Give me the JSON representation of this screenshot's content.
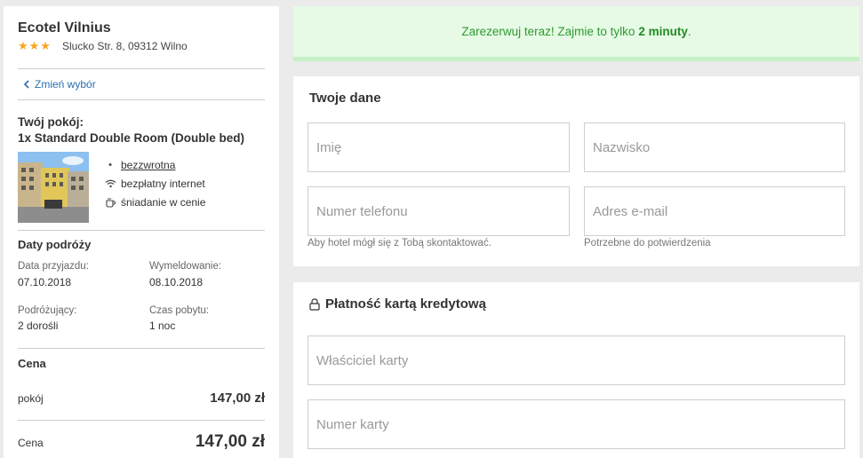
{
  "hotel": {
    "name": "Ecotel Vilnius",
    "stars": "★★★",
    "address": "Slucko Str. 8, 09312 Wilno"
  },
  "change_selection": "Zmień wybór",
  "room": {
    "line1": "Twój pokój:",
    "line2": "1x Standard Double Room (Double bed)",
    "features": [
      {
        "icon": "bullet-icon",
        "label": "bezzwrotna"
      },
      {
        "icon": "wifi-icon",
        "label": "bezpłatny internet"
      },
      {
        "icon": "coffee-cup-icon",
        "label": "śniadanie w cenie"
      }
    ]
  },
  "travel": {
    "title": "Daty podróży",
    "checkin_label": "Data przyjazdu:",
    "checkin_value": "07.10.2018",
    "checkout_label": "Wymeldowanie:",
    "checkout_value": "08.10.2018",
    "guests_label": "Podróżujący:",
    "guests_value": "2 dorośli",
    "stay_label": "Czas pobytu:",
    "stay_value": "1 noc"
  },
  "price": {
    "title": "Cena",
    "room_label": "pokój",
    "room_value": "147,00 zł",
    "total_label": "Cena",
    "total_value": "147,00 zł"
  },
  "banner": {
    "text": "Zarezerwuj teraz! Zajmie to tylko",
    "highlight": "2 minuty",
    "suffix": "."
  },
  "personal": {
    "title": "Twoje dane",
    "first_name_placeholder": "Imię",
    "last_name_placeholder": "Nazwisko",
    "phone_placeholder": "Numer telefonu",
    "email_placeholder": "Adres e-mail",
    "phone_hint": "Aby hotel mógł się z Tobą skontaktować.",
    "email_hint": "Potrzebne do potwierdzenia"
  },
  "payment": {
    "title": "Płatność kartą kredytową",
    "card_owner_placeholder": "Właściciel karty",
    "card_number_placeholder": "Numer karty"
  },
  "colors": {
    "accent_green": "#2f9a2f",
    "star": "#f5a623",
    "link": "#2a6fb0"
  }
}
